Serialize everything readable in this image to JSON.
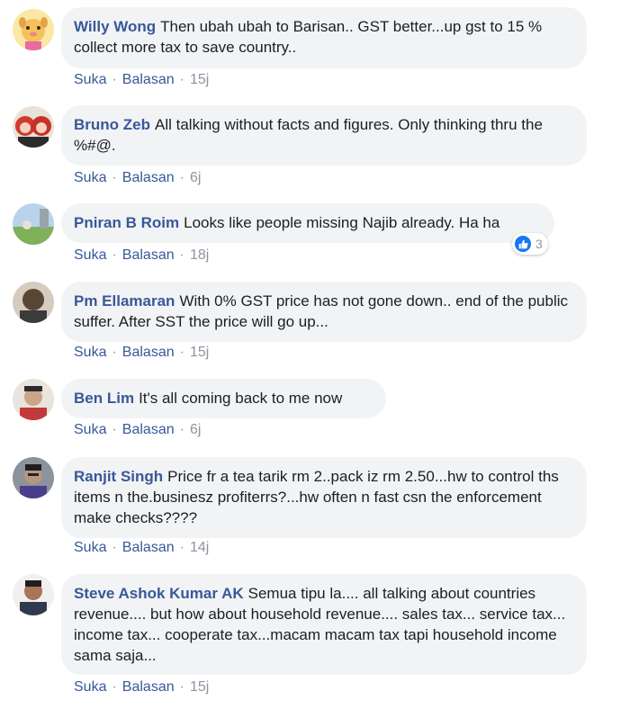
{
  "actions": {
    "like": "Suka",
    "reply": "Balasan",
    "dot": "·"
  },
  "comments": [
    {
      "author": "Willy Wong",
      "text": "Then ubah ubah to Barisan.. GST better...up gst to 15 % collect more tax to save country..",
      "time": "15j",
      "avatar_color": "#f6d365"
    },
    {
      "author": "Bruno Zeb",
      "text": "All talking without facts and figures. Only thinking thru the %#@.",
      "time": "6j",
      "avatar_color": "#d23a2c"
    },
    {
      "author": "Pniran B Roim",
      "text": "Looks like people missing Najib already. Ha ha",
      "time": "18j",
      "avatar_color": "#7fb05a",
      "reactions": "3"
    },
    {
      "author": "Pm Ellamaran",
      "text": "With 0% GST price has not gone down.. end of the public suffer. After SST the price will go up...",
      "time": "15j",
      "avatar_color": "#5a4634"
    },
    {
      "author": "Ben Lim",
      "text": "It's all coming back to me now",
      "time": "6j",
      "avatar_color": "#c9b7a0"
    },
    {
      "author": "Ranjit Singh",
      "text": "Price fr a tea tarik rm 2..pack iz rm 2.50...hw to control ths items n the.businesz profiterrs?...hw often n fast csn the enforcement make checks????",
      "time": "14j",
      "avatar_color": "#7a7f8a"
    },
    {
      "author": "Steve Ashok Kumar AK",
      "text": "Semua tipu la.... all talking about countries revenue.... but how about household revenue.... sales tax... service tax... income tax... cooperate tax...macam macam tax tapi household income sama saja...",
      "time": "15j",
      "avatar_color": "#2f3a4e"
    }
  ]
}
